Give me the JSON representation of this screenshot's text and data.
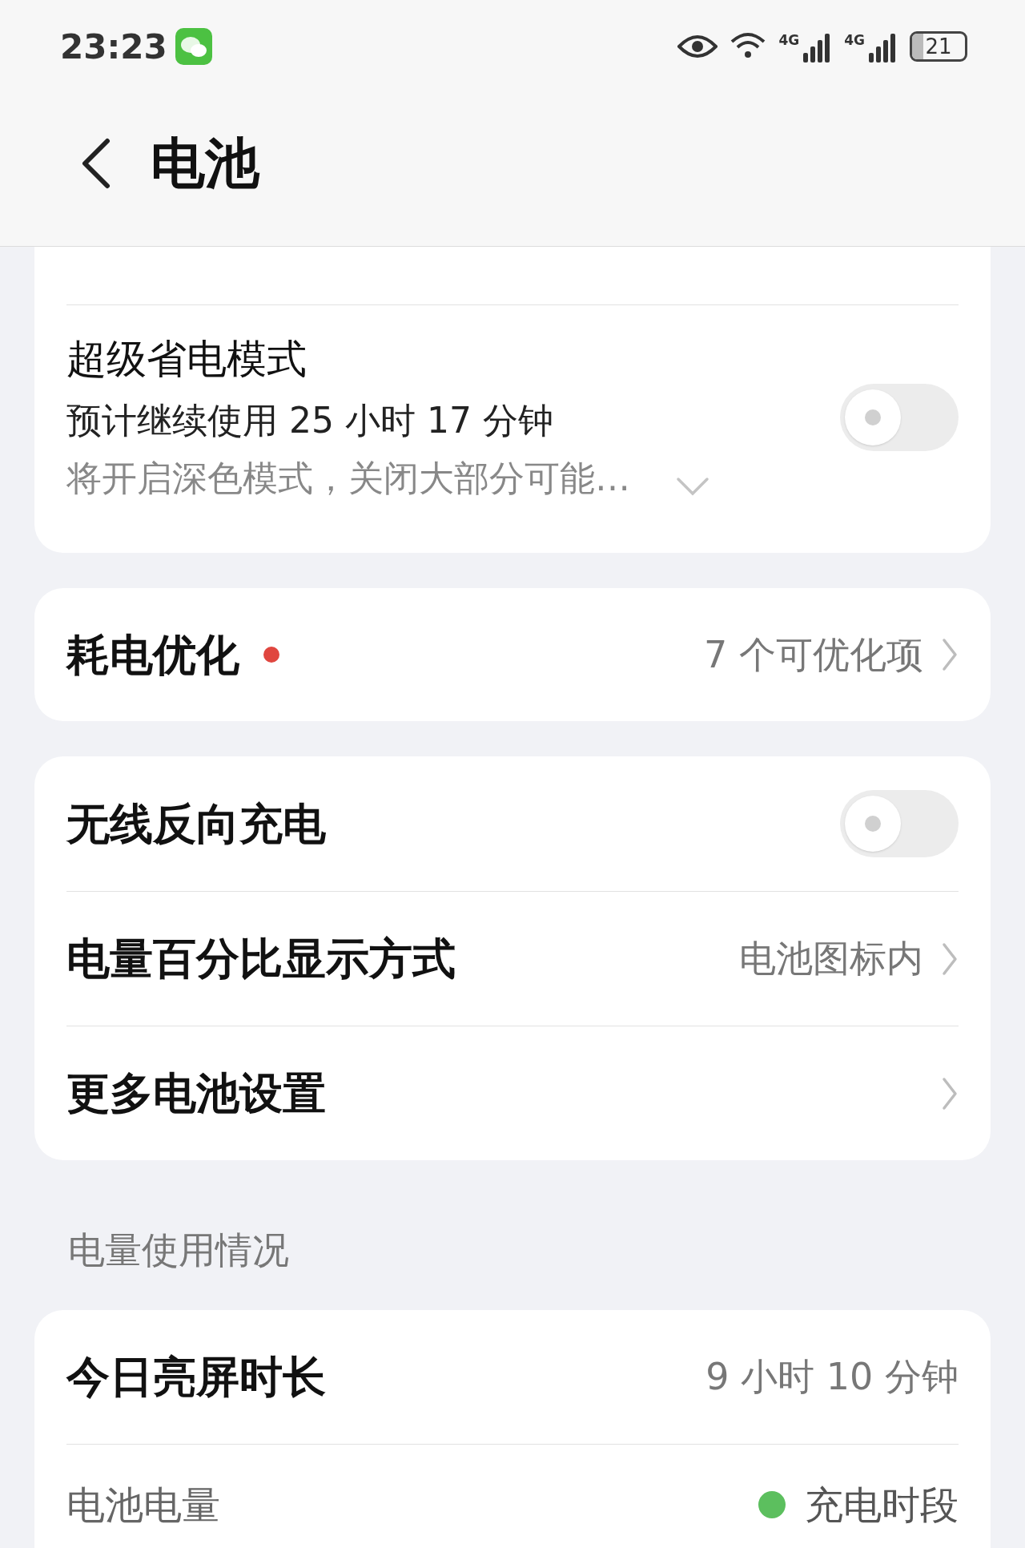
{
  "status_bar": {
    "time": "23:23",
    "network_1": "4G",
    "network_2": "4G",
    "battery": "21"
  },
  "header": {
    "title": "电池"
  },
  "super_saver": {
    "title": "超级省电模式",
    "subtitle": "预计继续使用 25 小时 17 分钟",
    "description": "将开启深色模式，关闭大部分可能…",
    "on": false,
    "expanded": false
  },
  "optimize": {
    "title": "耗电优化",
    "badge": {
      "color": "#e0463f"
    },
    "value": "7 个可优化项"
  },
  "settings": [
    {
      "kind": "toggle",
      "title": "无线反向充电",
      "on": false
    },
    {
      "kind": "link",
      "title": "电量百分比显示方式",
      "value": "电池图标内"
    },
    {
      "kind": "link",
      "title": "更多电池设置"
    }
  ],
  "usage": {
    "heading": "电量使用情况",
    "screen_time": {
      "title": "今日亮屏时长",
      "value": "9 小时 10 分钟"
    },
    "battery_level": {
      "title": "电池电量",
      "legend": {
        "label": "充电时段",
        "color": "#5cbf5e"
      }
    }
  }
}
